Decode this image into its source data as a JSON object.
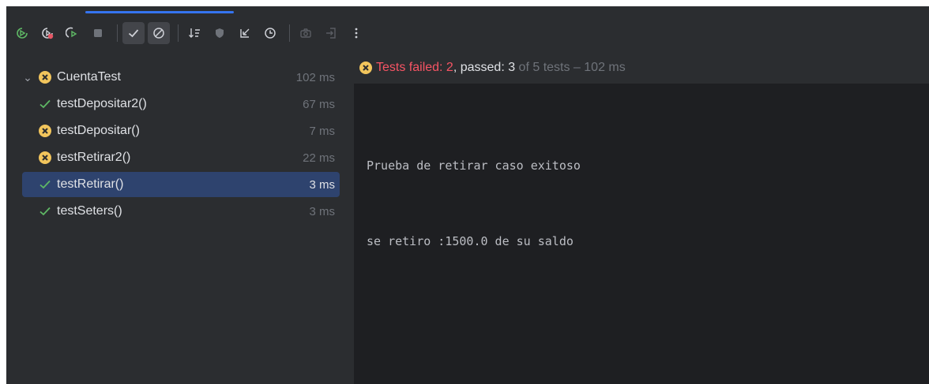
{
  "toolbar": {
    "buttons": [
      "rerun-icon",
      "rerun-failed-icon",
      "toggle-auto-test-icon",
      "stop-icon",
      "show-passed-icon",
      "show-ignored-icon",
      "sort-icon",
      "coverage-icon",
      "collapse-icon",
      "history-icon",
      "screenshot-icon",
      "export-icon",
      "more-icon"
    ]
  },
  "tree": {
    "root": {
      "label": "CuentaTest",
      "duration": "102 ms",
      "status": "failed"
    },
    "items": [
      {
        "label": "testDepositar2()",
        "duration": "67 ms",
        "status": "passed"
      },
      {
        "label": "testDepositar()",
        "duration": "7 ms",
        "status": "failed"
      },
      {
        "label": "testRetirar2()",
        "duration": "22 ms",
        "status": "failed"
      },
      {
        "label": "testRetirar()",
        "duration": "3 ms",
        "status": "passed",
        "selected": true
      },
      {
        "label": "testSeters()",
        "duration": "3 ms",
        "status": "passed"
      }
    ]
  },
  "status": {
    "failed_text": "Tests failed: 2",
    "sep": ", ",
    "passed_text": "passed: 3",
    "of_text": " of 5 tests – 102 ms"
  },
  "console": {
    "lines": [
      "Prueba de retirar caso exitoso",
      "se retiro :1500.0 de su saldo"
    ]
  },
  "colors": {
    "pass": "#5fb865",
    "fail": "#f2c55c",
    "selected": "#2e436e",
    "accent": "#3574f0"
  }
}
